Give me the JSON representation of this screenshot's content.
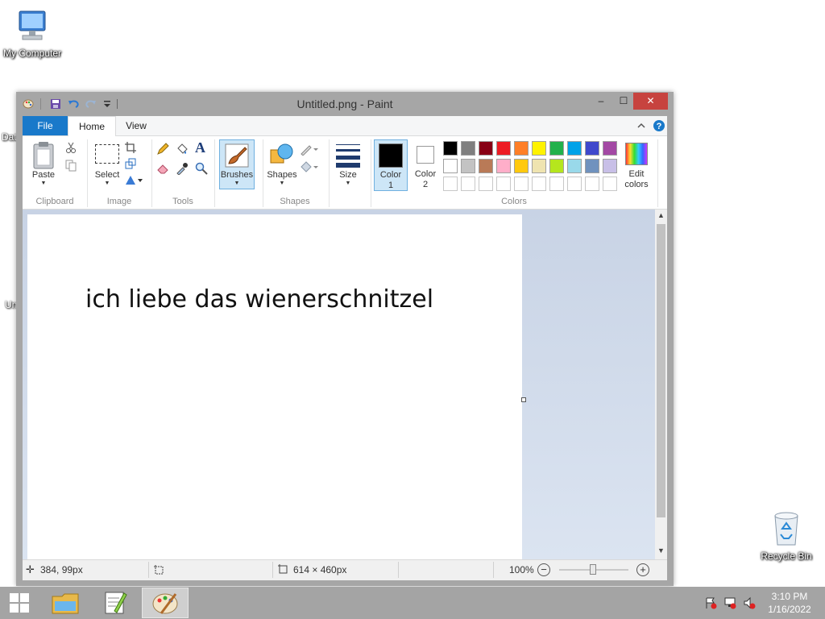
{
  "desktop": {
    "icons": [
      {
        "label": "My Computer"
      },
      {
        "label": "Recycle Bin"
      }
    ],
    "clipped_labels": [
      "Dat",
      "Un"
    ]
  },
  "window": {
    "title": "Untitled.png - Paint",
    "controls": {
      "minimize": "–",
      "maximize": "☐",
      "close": "✕"
    }
  },
  "ribbon": {
    "tabs": [
      "File",
      "Home",
      "View"
    ],
    "buttons": {
      "paste": "Paste",
      "select": "Select",
      "brushes": "Brushes",
      "shapes": "Shapes",
      "size": "Size",
      "color1": "Color 1",
      "color2": "Color 2",
      "edit_colors": "Edit colors"
    },
    "groups": [
      "Clipboard",
      "Image",
      "Tools",
      "Shapes",
      "Colors"
    ],
    "palette_row1": [
      "#000000",
      "#7f7f7f",
      "#880015",
      "#ed1c24",
      "#ff7f27",
      "#fff200",
      "#22b14c",
      "#00a2e8",
      "#3f48cc",
      "#a349a4"
    ],
    "palette_row2": [
      "#ffffff",
      "#c3c3c3",
      "#b97a57",
      "#ffaec9",
      "#ffc90e",
      "#efe4b0",
      "#b5e61d",
      "#99d9ea",
      "#7092be",
      "#c8bfe7"
    ],
    "color1_value": "#000000",
    "color2_value": "#ffffff"
  },
  "canvas": {
    "text": "ich liebe das wienerschnitzel"
  },
  "status": {
    "cursor_pos": "384, 99px",
    "selection_size": "",
    "image_size": "614 × 460px",
    "zoom": "100%"
  },
  "taskbar": {
    "time": "3:10 PM",
    "date": "1/16/2022"
  }
}
